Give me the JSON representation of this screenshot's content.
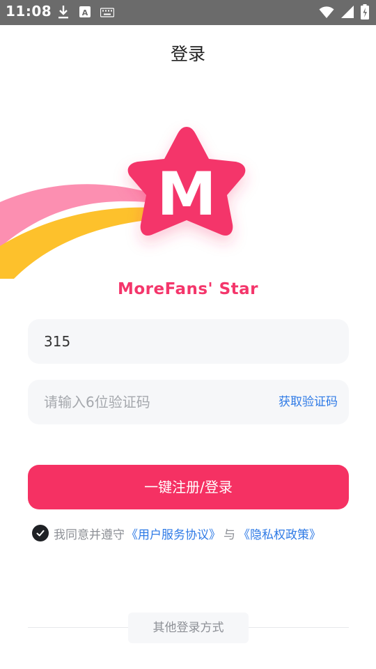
{
  "status_bar": {
    "time": "11:08",
    "icons_left": [
      "download-icon",
      "text-a-icon",
      "keyboard-icon"
    ],
    "icons_right": [
      "wifi-icon",
      "signal-icon",
      "battery-icon"
    ]
  },
  "header": {
    "title": "登录"
  },
  "brand": {
    "logo_letter": "M",
    "name": "MoreFans' Star",
    "colors": {
      "star": "#f4366b",
      "pink_trail": "#fc8fb1",
      "yellow_trail": "#fdc12c"
    }
  },
  "form": {
    "phone_value": "315",
    "code_placeholder": "请输入6位验证码",
    "get_code_label": "获取验证码"
  },
  "login_button": {
    "label": "一键注册/登录"
  },
  "agreement": {
    "prefix": "我同意并遵守",
    "user_agreement": "《用户服务协议》",
    "conjunction": "与",
    "privacy_policy": "《隐私权政策》"
  },
  "other_login": {
    "label": "其他登录方式"
  }
}
